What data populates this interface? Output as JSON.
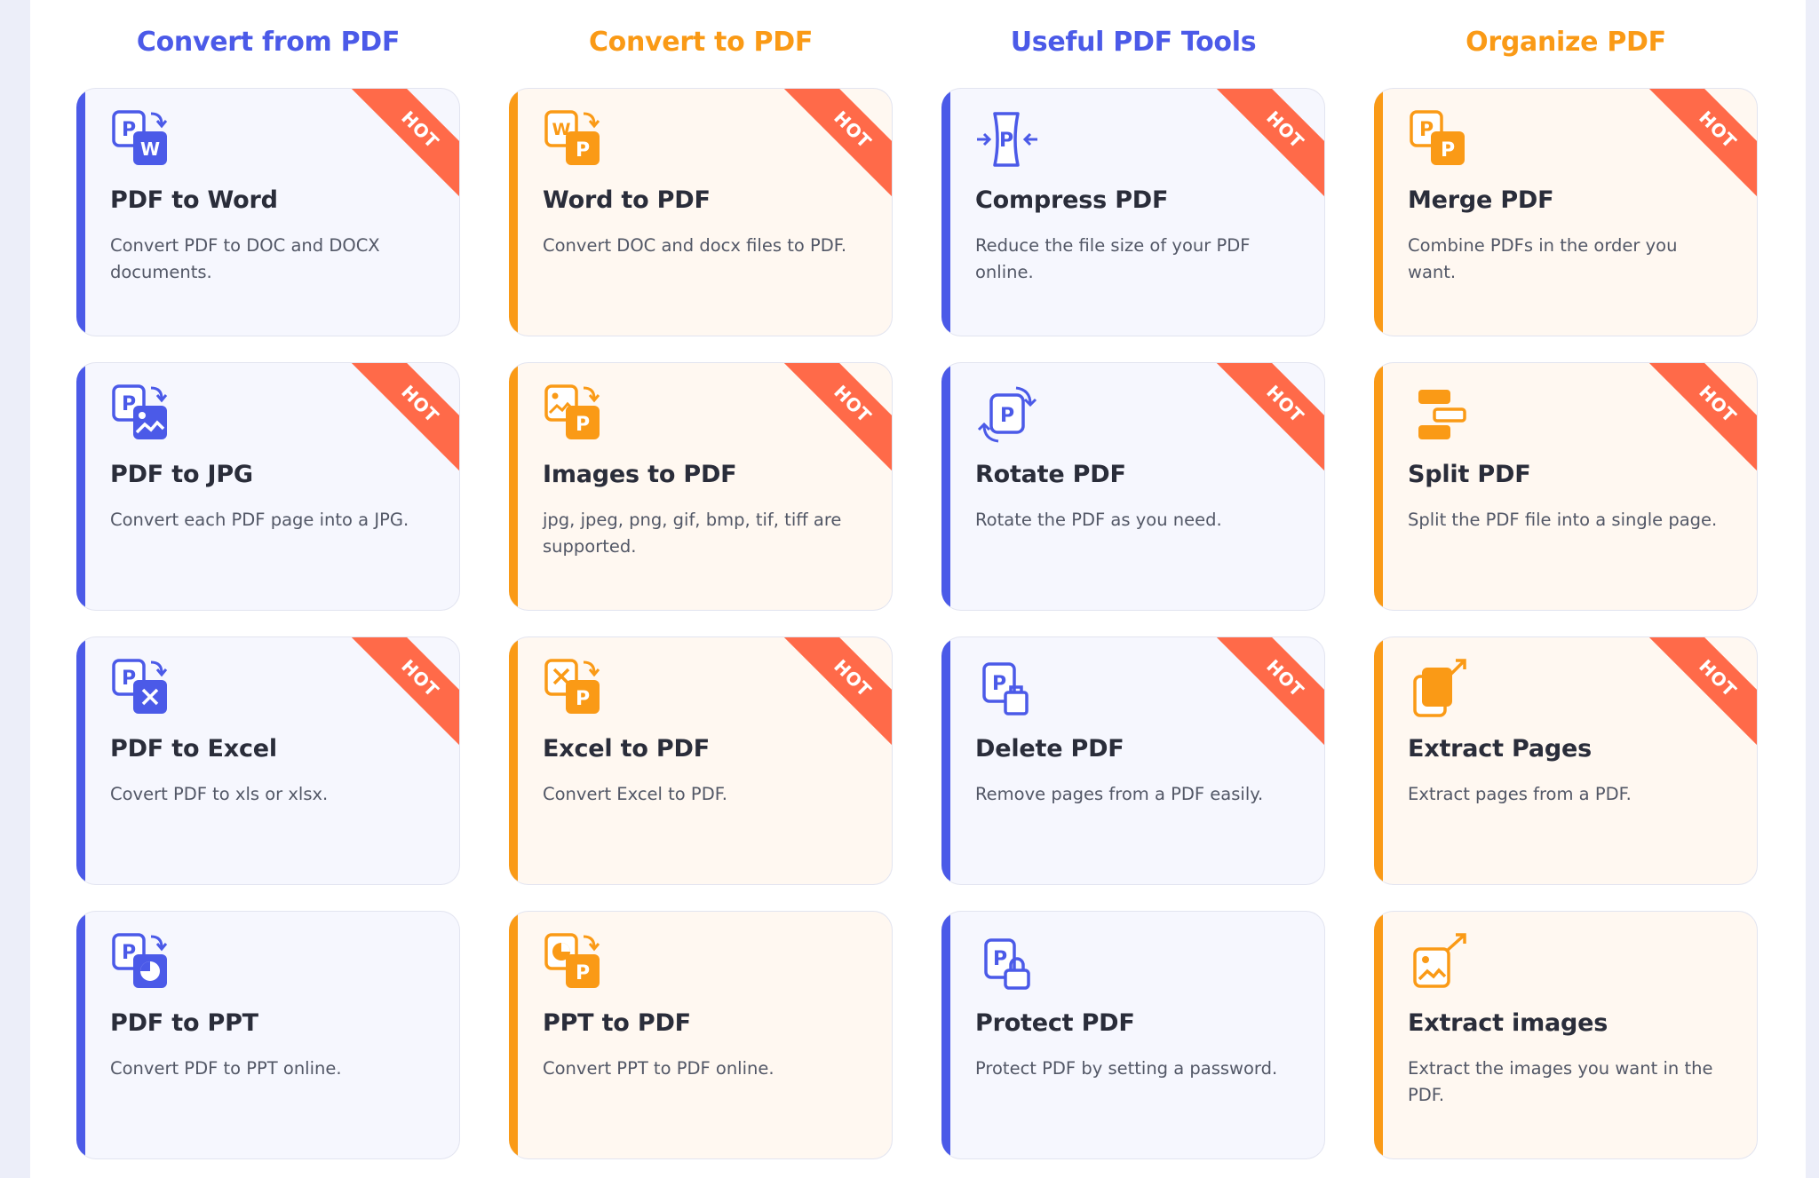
{
  "columns": [
    {
      "title": "Convert from PDF",
      "color": "#4b5ae8"
    },
    {
      "title": "Convert to PDF",
      "color": "#fa9a16"
    },
    {
      "title": "Useful PDF Tools",
      "color": "#4b5ae8"
    },
    {
      "title": "Organize PDF",
      "color": "#fa9a16"
    }
  ],
  "badge": "HOT",
  "cards": [
    [
      {
        "title": "PDF to Word",
        "desc": "Convert PDF to DOC and DOCX documents.",
        "hot": true,
        "icon": "pdf-to-word-icon"
      },
      {
        "title": "PDF to JPG",
        "desc": "Convert each PDF page into a JPG.",
        "hot": true,
        "icon": "pdf-to-jpg-icon"
      },
      {
        "title": "PDF to Excel",
        "desc": "Covert PDF to xls or xlsx.",
        "hot": true,
        "icon": "pdf-to-excel-icon"
      },
      {
        "title": "PDF to PPT",
        "desc": "Convert PDF to PPT online.",
        "hot": false,
        "icon": "pdf-to-ppt-icon"
      }
    ],
    [
      {
        "title": "Word to PDF",
        "desc": "Convert DOC and docx files to PDF.",
        "hot": true,
        "icon": "word-to-pdf-icon"
      },
      {
        "title": "Images to PDF",
        "desc": "jpg, jpeg, png, gif, bmp, tif, tiff are supported.",
        "hot": true,
        "icon": "images-to-pdf-icon"
      },
      {
        "title": "Excel to PDF",
        "desc": "Convert Excel to PDF.",
        "hot": true,
        "icon": "excel-to-pdf-icon"
      },
      {
        "title": "PPT to PDF",
        "desc": "Convert PPT to PDF online.",
        "hot": false,
        "icon": "ppt-to-pdf-icon"
      }
    ],
    [
      {
        "title": "Compress PDF",
        "desc": "Reduce the file size of your PDF online.",
        "hot": true,
        "icon": "compress-pdf-icon"
      },
      {
        "title": "Rotate PDF",
        "desc": "Rotate the PDF as you need.",
        "hot": true,
        "icon": "rotate-pdf-icon"
      },
      {
        "title": "Delete PDF",
        "desc": "Remove pages from a PDF easily.",
        "hot": true,
        "icon": "delete-pdf-icon"
      },
      {
        "title": "Protect PDF",
        "desc": "Protect PDF by setting a password.",
        "hot": false,
        "icon": "protect-pdf-icon"
      }
    ],
    [
      {
        "title": "Merge PDF",
        "desc": "Combine PDFs in the order you want.",
        "hot": true,
        "icon": "merge-pdf-icon"
      },
      {
        "title": "Split PDF",
        "desc": "Split the PDF file into a single page.",
        "hot": true,
        "icon": "split-pdf-icon"
      },
      {
        "title": "Extract Pages",
        "desc": "Extract pages from a PDF.",
        "hot": true,
        "icon": "extract-pages-icon"
      },
      {
        "title": "Extract images",
        "desc": "Extract the images you want in the PDF.",
        "hot": false,
        "icon": "extract-images-icon"
      }
    ]
  ]
}
